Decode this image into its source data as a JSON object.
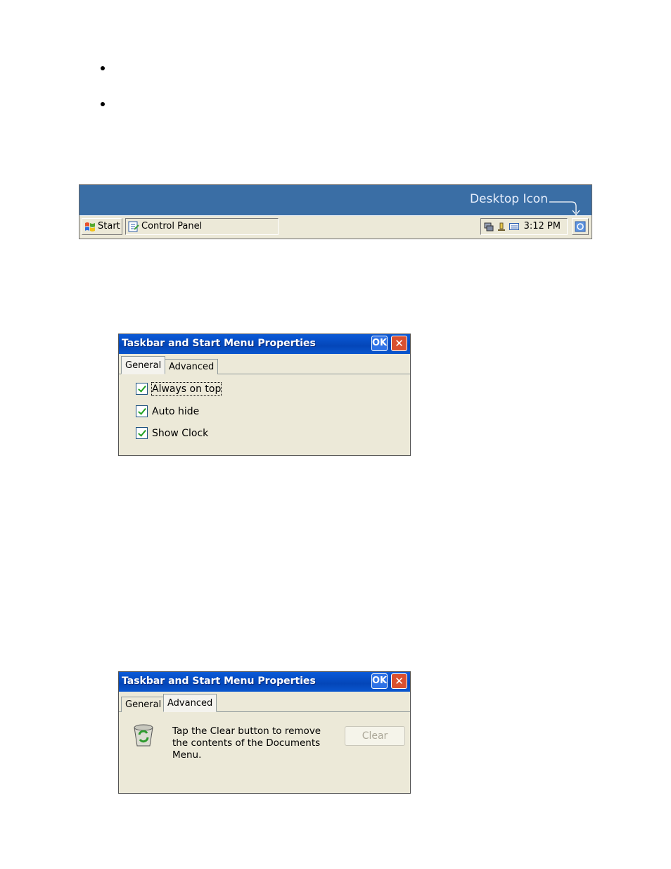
{
  "taskbar": {
    "label": "Desktop Icon",
    "start_label": "Start",
    "control_panel_label": "Control Panel",
    "clock": "3:12 PM"
  },
  "dialog_general": {
    "title": "Taskbar and Start Menu Properties",
    "ok_label": "OK",
    "close_label": "✕",
    "tabs": [
      "General",
      "Advanced"
    ],
    "active_tab": "General",
    "options": [
      {
        "label": "Always on top",
        "checked": true
      },
      {
        "label": "Auto hide",
        "checked": true
      },
      {
        "label": "Show Clock",
        "checked": true
      }
    ]
  },
  "dialog_advanced": {
    "title": "Taskbar and Start Menu Properties",
    "ok_label": "OK",
    "close_label": "✕",
    "tabs": [
      "General",
      "Advanced"
    ],
    "active_tab": "Advanced",
    "description": "Tap the Clear button to remove the contents of the Documents Menu.",
    "clear_label": "Clear"
  }
}
